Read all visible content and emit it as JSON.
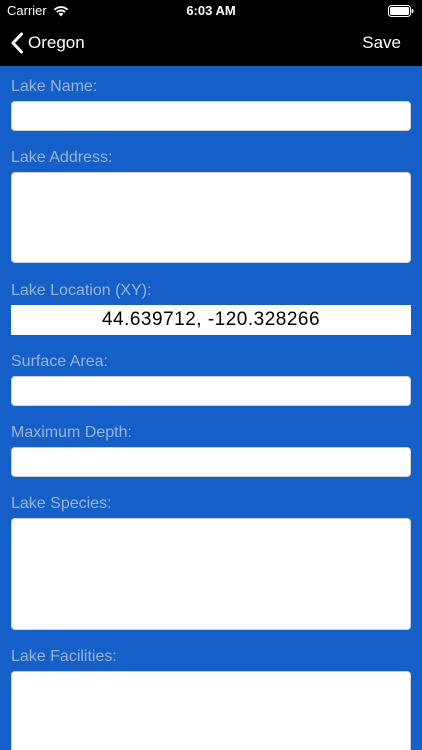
{
  "status_bar": {
    "carrier": "Carrier",
    "time": "6:03 AM"
  },
  "nav": {
    "back_label": "Oregon",
    "save_label": "Save"
  },
  "form": {
    "lake_name": {
      "label": "Lake Name:",
      "value": ""
    },
    "lake_address": {
      "label": "Lake Address:",
      "value": ""
    },
    "lake_location": {
      "label": "Lake Location (XY):",
      "value": "44.639712, -120.328266"
    },
    "surface_area": {
      "label": "Surface Area:",
      "value": ""
    },
    "maximum_depth": {
      "label": "Maximum Depth:",
      "value": ""
    },
    "lake_species": {
      "label": "Lake Species:",
      "value": ""
    },
    "lake_facilities": {
      "label": "Lake Facilities:",
      "value": ""
    }
  },
  "colors": {
    "background": "#1560c8",
    "bar": "#000000",
    "label": "#9ab3d7",
    "field": "#ffffff"
  },
  "icons": [
    "wifi-icon",
    "battery-icon",
    "chevron-left-icon"
  ]
}
